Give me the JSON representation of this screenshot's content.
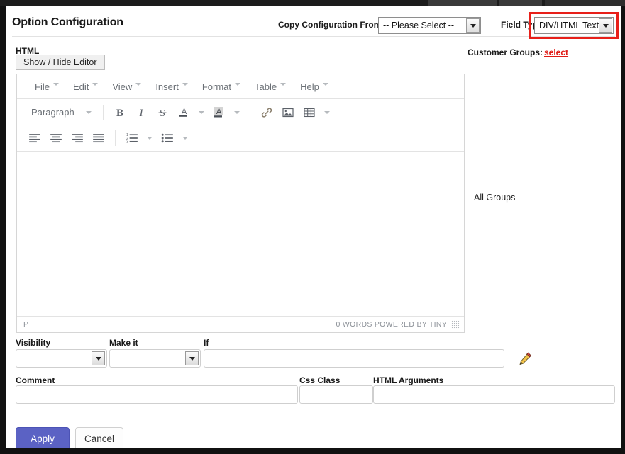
{
  "header": {
    "title": "Option Configuration",
    "copy_label": "Copy Configuration From:",
    "copy_value": "-- Please Select --",
    "field_type_label": "Field Type",
    "field_type_value": "DIV/HTML Text",
    "customer_groups_label": "Customer Groups:",
    "customer_groups_link": "select",
    "highlight_color": "#e8201a"
  },
  "html_section": {
    "label": "HTML",
    "show_hide_button": "Show / Hide Editor"
  },
  "editor": {
    "menu": [
      {
        "label": "File"
      },
      {
        "label": "Edit"
      },
      {
        "label": "View"
      },
      {
        "label": "Insert"
      },
      {
        "label": "Format"
      },
      {
        "label": "Table"
      },
      {
        "label": "Help"
      }
    ],
    "format_select": "Paragraph",
    "toolbar_row1": [
      {
        "name": "bold",
        "glyph": "B"
      },
      {
        "name": "italic",
        "glyph": "I"
      },
      {
        "name": "strikethrough",
        "glyph": "S"
      },
      {
        "name": "text-color",
        "glyph": "A"
      },
      {
        "name": "background-color",
        "glyph": "A"
      },
      {
        "name": "link",
        "glyph": "link"
      },
      {
        "name": "image",
        "glyph": "image"
      },
      {
        "name": "table",
        "glyph": "table"
      }
    ],
    "toolbar_row2": [
      {
        "name": "align-left"
      },
      {
        "name": "align-center"
      },
      {
        "name": "align-right"
      },
      {
        "name": "align-justify"
      },
      {
        "name": "numbered-list"
      },
      {
        "name": "bullet-list"
      }
    ],
    "content": "",
    "status_path": "P",
    "status_words": "0 WORDS POWERED BY TINY"
  },
  "groups_panel": {
    "all_groups": "All Groups"
  },
  "form": {
    "visibility_label": "Visibility",
    "visibility_value": "",
    "make_it_label": "Make it",
    "make_it_value": "",
    "if_label": "If",
    "if_value": "",
    "comment_label": "Comment",
    "comment_value": "",
    "css_class_label": "Css Class",
    "css_class_value": "",
    "html_arguments_label": "HTML Arguments",
    "html_arguments_value": "",
    "edit_icon": "pencil-icon"
  },
  "footer": {
    "apply_label": "Apply",
    "cancel_label": "Cancel",
    "apply_color": "#5b62c4"
  }
}
